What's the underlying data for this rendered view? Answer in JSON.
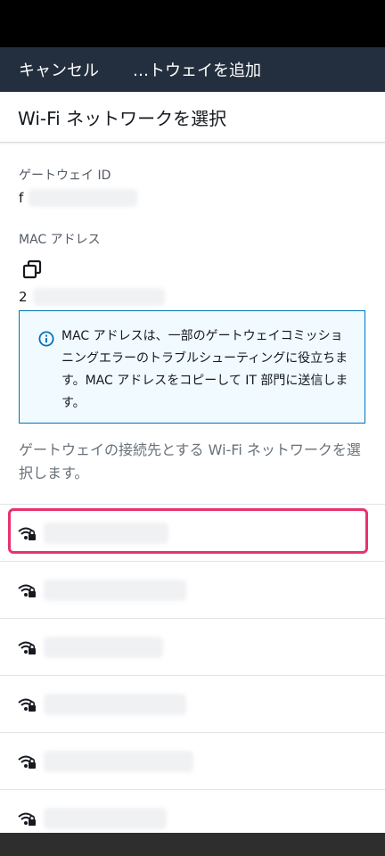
{
  "header": {
    "cancel_label": "キャンセル",
    "title": "…トウェイを追加"
  },
  "page": {
    "title": "Wi-Fi ネットワークを選択"
  },
  "gateway": {
    "id_label": "ゲートウェイ ID",
    "id_value_visible": "f"
  },
  "mac": {
    "label": "MAC アドレス",
    "value_visible": "2"
  },
  "info": {
    "text": "MAC アドレスは、一部のゲートウェイコミッショニングエラーのトラブルシューティングに役立ちます。MAC アドレスをコピーして IT 部門に送信します。"
  },
  "instruction": "ゲートウェイの接続先とする Wi-Fi ネットワークを選択します。",
  "colors": {
    "header_bg": "#232f3e",
    "info_border": "#0073bb",
    "info_bg": "#f1faff",
    "highlight": "#e8336d"
  },
  "networks": [
    {
      "icon": "wifi-lock-icon",
      "name_obscured": true,
      "highlighted": true
    },
    {
      "icon": "wifi-lock-icon",
      "name_obscured": true,
      "highlighted": false
    },
    {
      "icon": "wifi-lock-icon",
      "name_obscured": true,
      "highlighted": false
    },
    {
      "icon": "wifi-lock-icon",
      "name_obscured": true,
      "highlighted": false
    },
    {
      "icon": "wifi-lock-icon",
      "name_obscured": true,
      "highlighted": false
    },
    {
      "icon": "wifi-lock-icon",
      "name_obscured": true,
      "highlighted": false
    }
  ]
}
